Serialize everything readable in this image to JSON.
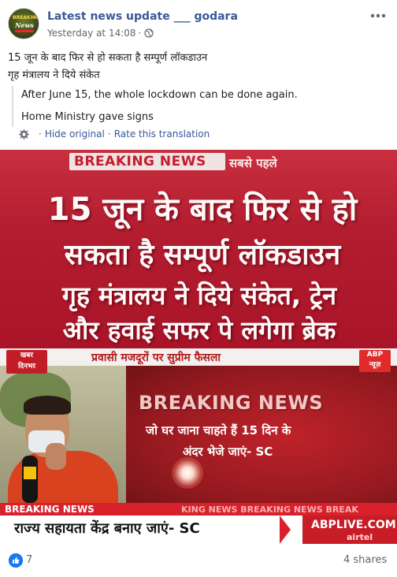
{
  "post": {
    "page_name": "Latest news update ___ godara",
    "avatar_text": {
      "top": "BREAKING",
      "middle": "News",
      "bottom": "update"
    },
    "timestamp": "Yesterday at 14:08",
    "separator": "·",
    "audience_icon": "globe-icon",
    "more_icon": "more-options-icon"
  },
  "text": {
    "original_line1": "15 जून के बाद फिर से हो सकता है सम्पूर्ण लॉकडाउन",
    "original_line2": "गृह मंत्रालय ने दिये संकेत",
    "translation_line1": "After June 15, the whole lockdown can be done again.",
    "translation_line2": "Home Ministry gave signs",
    "hide_original": "Hide original",
    "link_separator": "·",
    "rate_translation": "Rate this translation"
  },
  "image1": {
    "badge": "BREAKING NEWS",
    "badge_hindi": "सबसे पहले",
    "line1": "15 जून के बाद फिर से हो",
    "line2": "सकता है सम्पूर्ण लॉकडाउन",
    "line3": "गृह मंत्रालय ने दिये संकेत, ट्रेन",
    "line4": "और हवाई सफर पे लगेगा ब्रेक"
  },
  "image2": {
    "top_banner": "प्रवासी मजदूरों पर सुप्रीम फैसला",
    "corner_logo_line1": "खबर",
    "corner_logo_line2": "दिनभर",
    "channel_logo_line1": "ABP",
    "channel_logo_line2": "न्यूज़",
    "breaking_headline": "BREAKING NEWS",
    "sc_line1": "जो घर जाना चाहते हैं 15 दिन के",
    "sc_line2": "अंदर भेजे जाएं- SC",
    "ticker_label": "BREAKING NEWS",
    "ticker_scroll": "KING NEWS BREAKING NEWS BREAK",
    "ticker_main": "राज्य सहायता केंद्र बनाए जाएं- SC",
    "site": "ABPLIVE.COM",
    "sponsor": "airtel"
  },
  "footer": {
    "like_count": "7",
    "shares": "4 shares"
  },
  "colors": {
    "link_blue": "#385898",
    "meta_gray": "#606770",
    "like_blue": "#1877f2",
    "news_red": "#b41d30"
  }
}
